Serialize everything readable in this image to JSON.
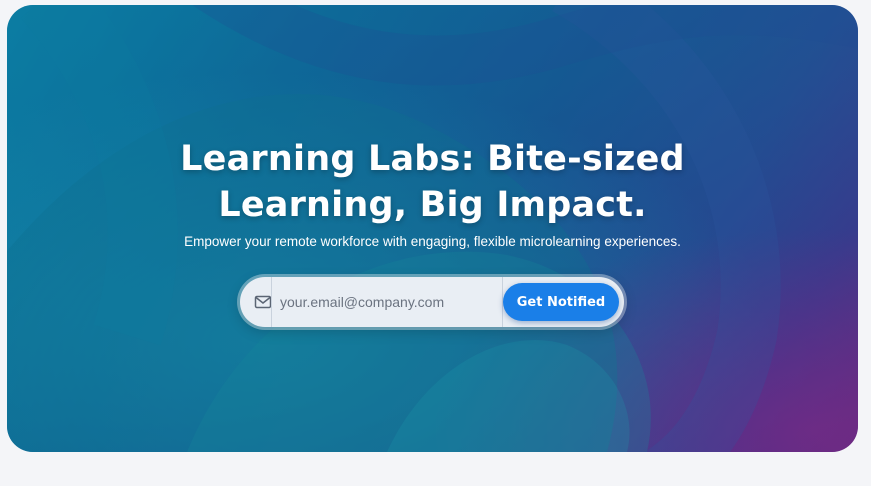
{
  "hero": {
    "title_line1": "Learning Labs: Bite-sized",
    "title_line2": "Learning, Big Impact.",
    "subtitle": "Empower your remote workforce with engaging, flexible microlearning experiences."
  },
  "signup": {
    "email_placeholder": "your.email@company.com",
    "email_icon": "mail-icon",
    "button_label": "Get Notified"
  },
  "colors": {
    "gradient_start": "#0b6f9a",
    "gradient_mid": "#1a3f86",
    "gradient_end": "#5a2a7e",
    "button": "#1a7fe8",
    "input_bg": "#e9eef4"
  }
}
